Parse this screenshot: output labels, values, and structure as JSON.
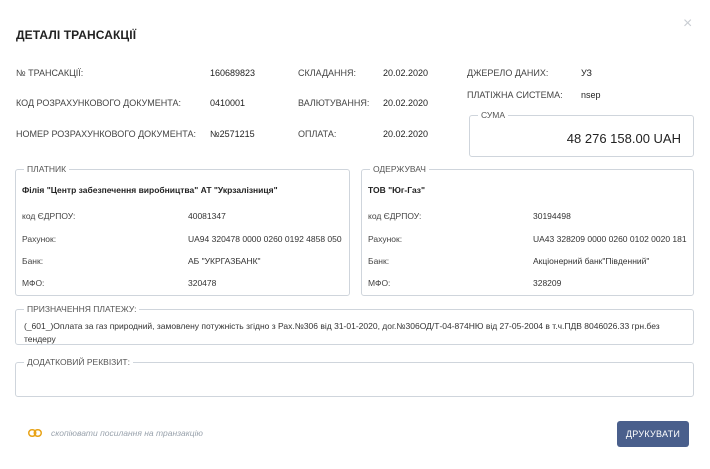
{
  "modal": {
    "title": "ДЕТАЛІ ТРАНСАКЦІЇ",
    "close_icon": "×"
  },
  "info": {
    "transaction_no_label": "№ ТРАНСАКЦІЇ:",
    "transaction_no_value": "160689823",
    "compose_label": "СКЛАДАННЯ:",
    "compose_value": "20.02.2020",
    "source_label": "ДЖЕРЕЛО ДАНИХ:",
    "source_value": "УЗ",
    "doc_code_label": "КОД РОЗРАХУНКОВОГО ДОКУМЕНТА:",
    "doc_code_value": "0410001",
    "valuation_label": "ВАЛЮТУВАННЯ:",
    "valuation_value": "20.02.2020",
    "payment_system_label": "ПЛАТІЖНА СИСТЕМА:",
    "payment_system_value": "nsep",
    "doc_no_label": "НОМЕР РОЗРАХУНКОВОГО ДОКУМЕНТА:",
    "doc_no_value": "№2571215",
    "payment_label": "ОПЛАТА:",
    "payment_value": "20.02.2020"
  },
  "sum": {
    "label": "СУМА",
    "value": "48 276 158.00 UAH"
  },
  "payer": {
    "legend": "ПЛАТНИК",
    "name": "Філія \"Центр забезпечення виробництва\" АТ \"Укрзалізниця\"",
    "edrpou_label": "код ЄДРПОУ:",
    "edrpou_value": "40081347",
    "account_label": "Рахунок:",
    "account_value": "UA94 320478 0000 0260 0192 4858 050",
    "bank_label": "Банк:",
    "bank_value": "АБ \"УКРГАЗБАНК\"",
    "mfo_label": "МФО:",
    "mfo_value": "320478"
  },
  "payee": {
    "legend": "ОДЕРЖУВАЧ",
    "name": "ТОВ \"Юг-Газ\"",
    "edrpou_label": "код ЄДРПОУ:",
    "edrpou_value": "30194498",
    "account_label": "Рахунок:",
    "account_value": "UA43 328209 0000 0260 0102 0020 181",
    "bank_label": "Банк:",
    "bank_value": "Акціонерний банк\"Південний\"",
    "mfo_label": "МФО:",
    "mfo_value": "328209"
  },
  "purpose": {
    "legend": "ПРИЗНАЧЕННЯ ПЛАТЕЖУ:",
    "text": "(_601_)Оплата за газ природний, замовлену потужність згідно з Рах.№306 від 31-01-2020, дог.№306ОД/Т-04-874НЮ від 27-05-2004 в т.ч.ПДВ 8046026.33 грн.без тендеру"
  },
  "extra": {
    "legend": "ДОДАТКОВИЙ РЕКВІЗИТ:",
    "text": ""
  },
  "footer": {
    "copy_link_label": "скопіювати посилання на транзакцію",
    "print_label": "ДРУКУВАТИ"
  },
  "colors": {
    "accent": "#4a5f8c",
    "link_icon": "#e8a317",
    "border": "#cfd5dc"
  }
}
